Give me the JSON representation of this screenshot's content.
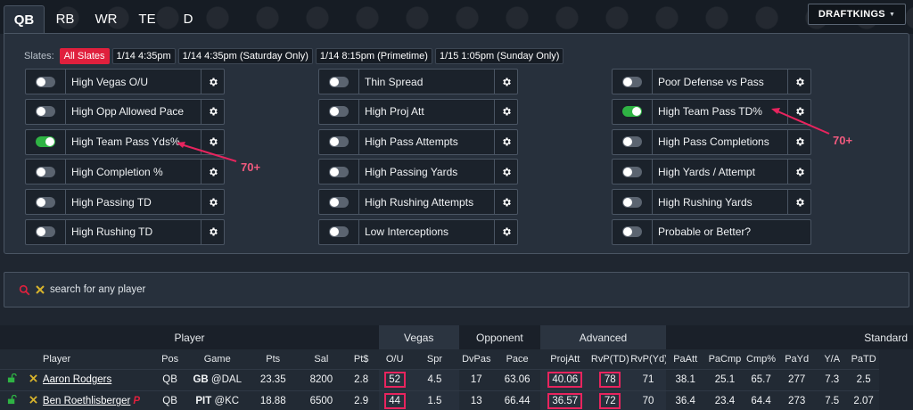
{
  "position_tabs": [
    "QB",
    "RB",
    "WR",
    "TE",
    "D"
  ],
  "site_select": {
    "value": "DRAFTKINGS"
  },
  "slates": {
    "label": "Slates:",
    "options": [
      "All Slates",
      "1/14 4:35pm",
      "1/14 4:35pm (Saturday Only)",
      "1/14 8:15pm (Primetime)",
      "1/15 1:05pm (Sunday Only)"
    ],
    "selected": "All Slates"
  },
  "filters": {
    "col1": [
      {
        "label": "High Vegas O/U",
        "on": false
      },
      {
        "label": "High Opp Allowed Pace",
        "on": false
      },
      {
        "label": "High Team Pass Yds%",
        "on": true
      },
      {
        "label": "High Completion %",
        "on": false
      },
      {
        "label": "High Passing TD",
        "on": false
      },
      {
        "label": "High Rushing TD",
        "on": false
      }
    ],
    "col2": [
      {
        "label": "Thin Spread",
        "on": false
      },
      {
        "label": "High Proj Att",
        "on": false
      },
      {
        "label": "High Pass Attempts",
        "on": false
      },
      {
        "label": "High Passing Yards",
        "on": false
      },
      {
        "label": "High Rushing Attempts",
        "on": false
      },
      {
        "label": "Low Interceptions",
        "on": false
      }
    ],
    "col3": [
      {
        "label": "Poor Defense vs Pass",
        "on": false
      },
      {
        "label": "High Team Pass TD%",
        "on": true
      },
      {
        "label": "High Pass Completions",
        "on": false
      },
      {
        "label": "High Yards / Attempt",
        "on": false
      },
      {
        "label": "High Rushing Yards",
        "on": false
      },
      {
        "label": "Probable or Better?",
        "on": false
      }
    ]
  },
  "annotations": [
    "70+",
    "70+"
  ],
  "search": {
    "placeholder": "search for any player"
  },
  "table": {
    "groups": [
      "Player",
      "Vegas",
      "Opponent",
      "Advanced",
      "Standard"
    ],
    "columns": [
      "Player",
      "Pos",
      "Game",
      "Pts",
      "Sal",
      "Pt$",
      "O/U",
      "Spr",
      "DvPas",
      "Pace",
      "ProjAtt",
      "RvP(TD)",
      "RvP(Yd)",
      "PaAtt",
      "PaCmp",
      "Cmp%",
      "PaYd",
      "Y/A",
      "PaTD"
    ],
    "rows": [
      {
        "player": "Aaron Rodgers",
        "badge": "",
        "pos": "QB",
        "team": "GB",
        "opp": "@DAL",
        "pts": "23.35",
        "sal": "8200",
        "ptd": "2.8",
        "ou": "52",
        "spr": "4.5",
        "dvpas": "17",
        "pace": "63.06",
        "projatt": "40.06",
        "rvptd": "78",
        "rvpyd": "71",
        "paatt": "38.1",
        "pacmp": "25.1",
        "cmp": "65.7",
        "payd": "277",
        "ya": "7.3",
        "patd": "2.5"
      },
      {
        "player": "Ben Roethlisberger",
        "badge": "P",
        "pos": "QB",
        "team": "PIT",
        "opp": "@KC",
        "pts": "18.88",
        "sal": "6500",
        "ptd": "2.9",
        "ou": "44",
        "spr": "1.5",
        "dvpas": "13",
        "pace": "66.44",
        "projatt": "36.57",
        "rvptd": "72",
        "rvpyd": "70",
        "paatt": "36.4",
        "pacmp": "23.4",
        "cmp": "64.4",
        "payd": "273",
        "ya": "7.5",
        "patd": "2.07"
      }
    ]
  },
  "colors": {
    "accent_red": "#e0203d",
    "toggle_on": "#2fb344",
    "annotation_pink": "#e8245e"
  }
}
